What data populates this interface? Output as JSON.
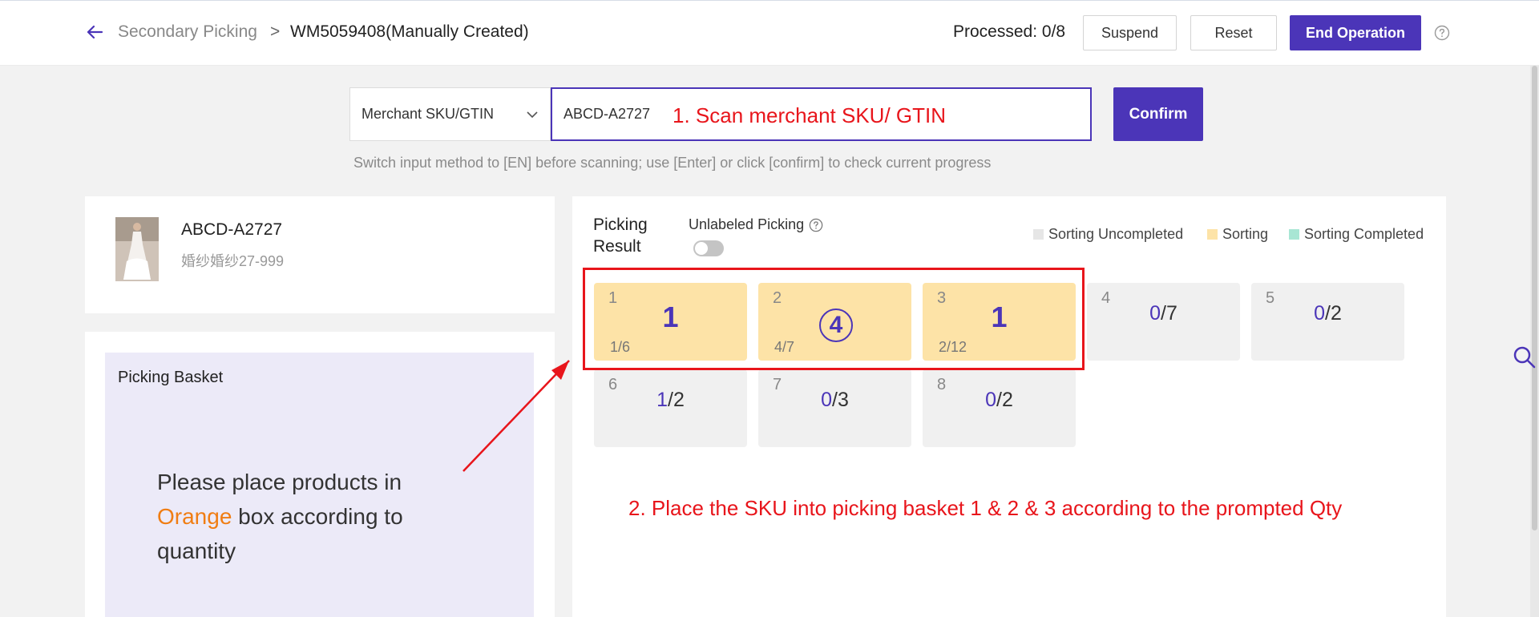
{
  "header": {
    "breadcrumb_parent": "Secondary Picking",
    "breadcrumb_sep": ">",
    "breadcrumb_current": "WM5059408(Manually Created)",
    "processed": "Processed: 0/8",
    "suspend_label": "Suspend",
    "reset_label": "Reset",
    "end_label": "End Operation"
  },
  "search": {
    "select_value": "Merchant SKU/GTIN",
    "input_value": "ABCD-A2727",
    "hint": "1. Scan merchant SKU/ GTIN",
    "confirm_label": "Confirm",
    "tip": "Switch input method to [EN] before scanning; use [Enter] or click [confirm] to check current progress"
  },
  "product": {
    "sku": "ABCD-A2727",
    "name": "婚纱婚纱27-999"
  },
  "basket": {
    "title": "Picking Basket",
    "msg_before": "Please place products in ",
    "msg_highlight": "Orange",
    "msg_after": " box according to quantity"
  },
  "result": {
    "label": "Picking Result",
    "unlabeled_label": "Unlabeled Picking",
    "unlabeled_on": false,
    "legend": [
      {
        "label": "Sorting Uncompleted",
        "color": "#e6e6e6"
      },
      {
        "label": "Sorting",
        "color": "#fde3a7"
      },
      {
        "label": "Sorting Completed",
        "color": "#a8e6d4"
      }
    ],
    "slots": [
      {
        "no": "1",
        "state": "sorting",
        "big": "1",
        "frac": "1/6"
      },
      {
        "no": "2",
        "state": "sorting",
        "circ": "4",
        "frac": "4/7"
      },
      {
        "no": "3",
        "state": "sorting",
        "big": "1",
        "frac": "2/12"
      },
      {
        "no": "4",
        "state": "idle",
        "done": "0",
        "total": "/7"
      },
      {
        "no": "5",
        "state": "idle",
        "done": "0",
        "total": "/2"
      },
      {
        "no": "6",
        "state": "idle",
        "done": "1",
        "total": "/2"
      },
      {
        "no": "7",
        "state": "idle",
        "done": "0",
        "total": "/3"
      },
      {
        "no": "8",
        "state": "idle",
        "done": "0",
        "total": "/2"
      }
    ],
    "instruction": "2. Place the SKU into picking basket 1 & 2 & 3 according to the prompted Qty"
  }
}
